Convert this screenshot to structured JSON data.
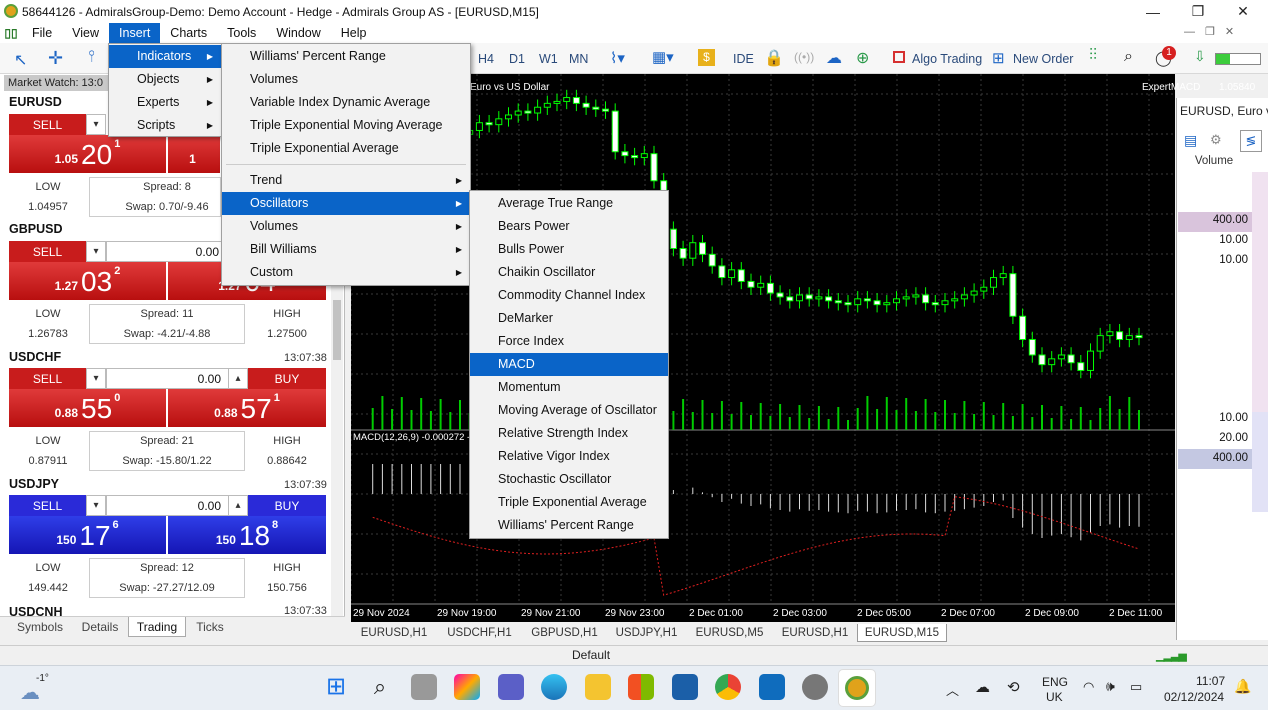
{
  "window": {
    "title": "58644126 - AdmiralsGroup-Demo: Demo Account - Hedge - Admirals Group AS - [EURUSD,M15]",
    "controls": [
      "—",
      "❐",
      "✕"
    ],
    "subcontrols": [
      "—",
      "❐",
      "✕"
    ]
  },
  "menubar": [
    "File",
    "View",
    "Insert",
    "Charts",
    "Tools",
    "Window",
    "Help"
  ],
  "toolbar": {
    "timeframes": [
      "H4",
      "D1",
      "W1",
      "MN"
    ],
    "ide": "IDE",
    "algo_trading": "Algo Trading",
    "new_order": "New Order",
    "notifications": "1"
  },
  "market_watch": {
    "header": "Market Watch: 13:0",
    "symbols": [
      {
        "name": "EURUSD",
        "time": "",
        "sell": "SELL",
        "buy": "",
        "volume": "",
        "bid_small": "1.05",
        "bid_big": "20",
        "bid_pip": "1",
        "ask_small": "1",
        "ask_big": "",
        "ask_pip": "",
        "low_label": "LOW",
        "low": "1.04957",
        "spread": "Spread: 8",
        "swap": "Swap: 0.70/-9.46",
        "high_label": "",
        "high": ""
      },
      {
        "name": "GBPUSD",
        "time": "",
        "sell": "SELL",
        "buy": "",
        "volume": "0.00",
        "bid_small": "1.27",
        "bid_big": "03",
        "bid_pip": "2",
        "ask_small": "1.27",
        "ask_big": "04",
        "ask_pip": "",
        "low_label": "LOW",
        "low": "1.26783",
        "spread": "Spread: 11",
        "swap": "Swap: -4.21/-4.88",
        "high_label": "HIGH",
        "high": "1.27500"
      },
      {
        "name": "USDCHF",
        "time": "13:07:38",
        "sell": "SELL",
        "buy": "BUY",
        "volume": "0.00",
        "bid_small": "0.88",
        "bid_big": "55",
        "bid_pip": "0",
        "ask_small": "0.88",
        "ask_big": "57",
        "ask_pip": "1",
        "low_label": "LOW",
        "low": "0.87911",
        "spread": "Spread: 21",
        "swap": "Swap: -15.80/1.22",
        "high_label": "HIGH",
        "high": "0.88642"
      },
      {
        "name": "USDJPY",
        "time": "13:07:39",
        "sell": "SELL",
        "buy": "BUY",
        "volume": "0.00",
        "bid_small": "150",
        "bid_big": "17",
        "bid_pip": "6",
        "ask_small": "150",
        "ask_big": "18",
        "ask_pip": "8",
        "low_label": "LOW",
        "low": "149.442",
        "spread": "Spread: 12",
        "swap": "Swap: -27.27/12.09",
        "high_label": "HIGH",
        "high": "150.756"
      },
      {
        "name": "USDCNH",
        "time": "13:07:33"
      }
    ],
    "tabs": [
      "Symbols",
      "Details",
      "Trading",
      "Ticks"
    ],
    "active_tab": "Trading"
  },
  "insert_menu": {
    "items": [
      "Indicators",
      "Objects",
      "Experts",
      "Scripts"
    ]
  },
  "indicators_menu": {
    "items": [
      "Williams' Percent Range",
      "Volumes",
      "Variable Index Dynamic Average",
      "Triple Exponential Moving Average",
      "Triple Exponential Average",
      "Trend",
      "Oscillators",
      "Volumes",
      "Bill Williams",
      "Custom"
    ]
  },
  "oscillators_menu": {
    "items": [
      "Average True Range",
      "Bears Power",
      "Bulls Power",
      "Chaikin Oscillator",
      "Commodity Channel Index",
      "DeMarker",
      "Force Index",
      "MACD",
      "Momentum",
      "Moving Average of Oscillator",
      "Relative Strength Index",
      "Relative Vigor Index",
      "Stochastic Oscillator",
      "Triple Exponential Average",
      "Williams' Percent Range"
    ],
    "selected": "MACD"
  },
  "chart": {
    "symbol_label": "Euro vs US Dollar",
    "expert_label": "ExpertMACD",
    "price_label": "1.05840",
    "macd_label": "MACD(12,26,9) -0.000272 -",
    "time_labels": [
      "29 Nov 2024",
      "29 Nov 19:00",
      "29 Nov 21:00",
      "29 Nov 23:00",
      "2 Dec 01:00",
      "2 Dec 03:00",
      "2 Dec 05:00",
      "2 Dec 07:00",
      "2 Dec 09:00",
      "2 Dec 11:00"
    ],
    "tabs": [
      "EURUSD,H1",
      "USDCHF,H1",
      "GBPUSD,H1",
      "USDJPY,H1",
      "EURUSD,M5",
      "EURUSD,H1",
      "EURUSD,M15"
    ],
    "active_tab": "EURUSD,M15",
    "candles": [
      1.0568,
      1.0572,
      1.0575,
      1.0577,
      1.0576,
      1.0578,
      1.0581,
      1.058,
      1.0583,
      1.0585,
      1.0584,
      1.0586,
      1.059,
      1.0589,
      1.0592,
      1.0594,
      1.0596,
      1.0595,
      1.0598,
      1.06,
      1.0601,
      1.0603,
      1.06,
      1.0598,
      1.0597,
      1.0596,
      1.0575,
      1.0573,
      1.0572,
      1.0574,
      1.056,
      1.0535,
      1.0525,
      1.052,
      1.0528,
      1.0522,
      1.0516,
      1.051,
      1.0514,
      1.0508,
      1.0505,
      1.0507,
      1.0502,
      1.05,
      1.0498,
      1.0501,
      1.0499,
      1.05,
      1.0498,
      1.0497,
      1.0496,
      1.0499,
      1.0498,
      1.0496,
      1.0497,
      1.0499,
      1.05,
      1.0501,
      1.0497,
      1.0496,
      1.0498,
      1.0499,
      1.0501,
      1.0503,
      1.0505,
      1.051,
      1.0512,
      1.049,
      1.0478,
      1.047,
      1.0465,
      1.0468,
      1.047,
      1.0466,
      1.0462,
      1.0472,
      1.048,
      1.0482,
      1.0478,
      1.048,
      1.0479
    ]
  },
  "right_panel": {
    "title": "EURUSD, Euro vs",
    "column": "Volume",
    "values": [
      "400.00",
      "10.00",
      "10.00",
      "10.00",
      "20.00",
      "400.00"
    ]
  },
  "status": {
    "profile": "Default"
  },
  "taskbar": {
    "weather": "-1°",
    "lang1": "ENG",
    "lang2": "UK",
    "time": "11:07",
    "date": "02/12/2024"
  },
  "colors": {
    "menu_highlight": "#0a64c8",
    "sell": "#c81c1c",
    "buy_blue": "#2a2ad8",
    "candle": "#00ff00"
  }
}
